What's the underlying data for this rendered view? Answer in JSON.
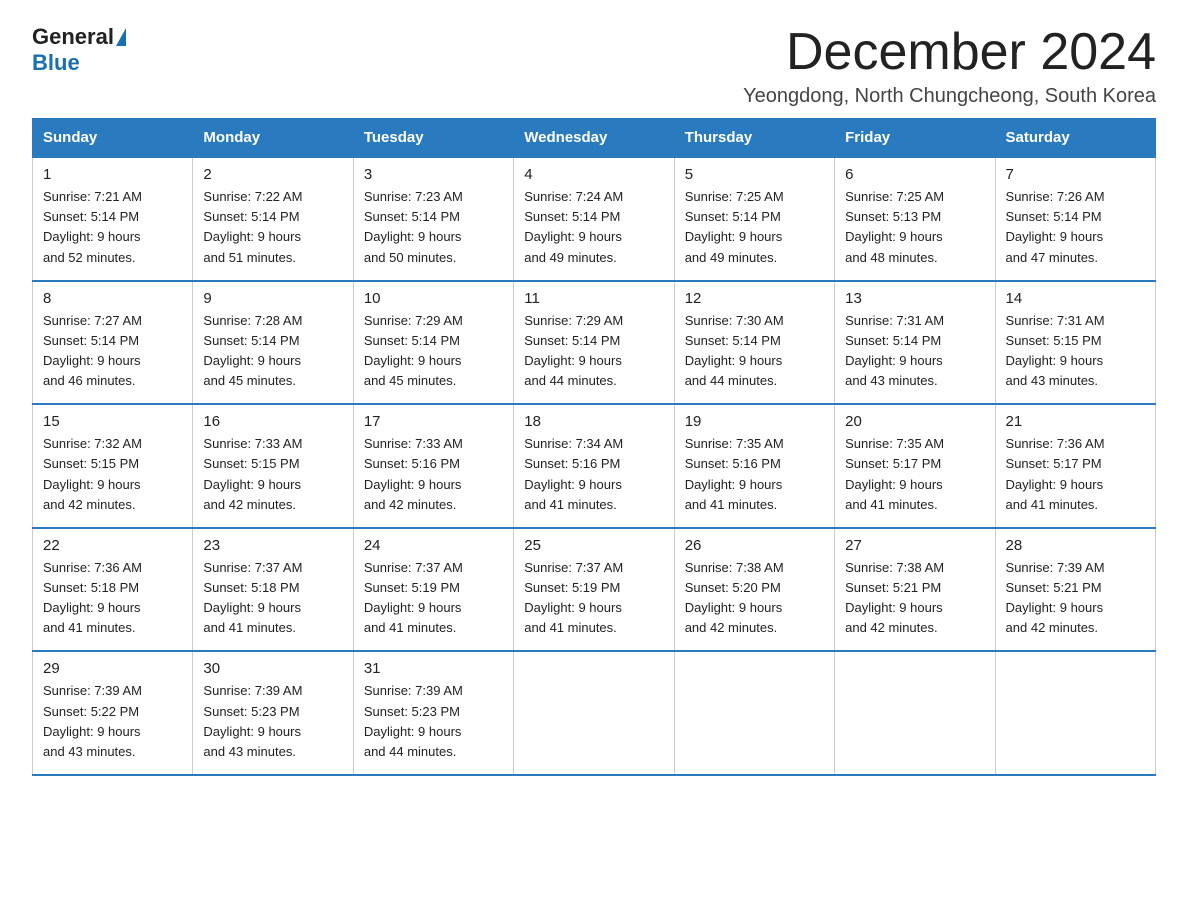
{
  "logo": {
    "general": "General",
    "blue": "Blue"
  },
  "header": {
    "month_title": "December 2024",
    "subtitle": "Yeongdong, North Chungcheong, South Korea"
  },
  "weekdays": [
    "Sunday",
    "Monday",
    "Tuesday",
    "Wednesday",
    "Thursday",
    "Friday",
    "Saturday"
  ],
  "weeks": [
    [
      {
        "day": "1",
        "sunrise": "7:21 AM",
        "sunset": "5:14 PM",
        "daylight": "9 hours and 52 minutes."
      },
      {
        "day": "2",
        "sunrise": "7:22 AM",
        "sunset": "5:14 PM",
        "daylight": "9 hours and 51 minutes."
      },
      {
        "day": "3",
        "sunrise": "7:23 AM",
        "sunset": "5:14 PM",
        "daylight": "9 hours and 50 minutes."
      },
      {
        "day": "4",
        "sunrise": "7:24 AM",
        "sunset": "5:14 PM",
        "daylight": "9 hours and 49 minutes."
      },
      {
        "day": "5",
        "sunrise": "7:25 AM",
        "sunset": "5:14 PM",
        "daylight": "9 hours and 49 minutes."
      },
      {
        "day": "6",
        "sunrise": "7:25 AM",
        "sunset": "5:13 PM",
        "daylight": "9 hours and 48 minutes."
      },
      {
        "day": "7",
        "sunrise": "7:26 AM",
        "sunset": "5:14 PM",
        "daylight": "9 hours and 47 minutes."
      }
    ],
    [
      {
        "day": "8",
        "sunrise": "7:27 AM",
        "sunset": "5:14 PM",
        "daylight": "9 hours and 46 minutes."
      },
      {
        "day": "9",
        "sunrise": "7:28 AM",
        "sunset": "5:14 PM",
        "daylight": "9 hours and 45 minutes."
      },
      {
        "day": "10",
        "sunrise": "7:29 AM",
        "sunset": "5:14 PM",
        "daylight": "9 hours and 45 minutes."
      },
      {
        "day": "11",
        "sunrise": "7:29 AM",
        "sunset": "5:14 PM",
        "daylight": "9 hours and 44 minutes."
      },
      {
        "day": "12",
        "sunrise": "7:30 AM",
        "sunset": "5:14 PM",
        "daylight": "9 hours and 44 minutes."
      },
      {
        "day": "13",
        "sunrise": "7:31 AM",
        "sunset": "5:14 PM",
        "daylight": "9 hours and 43 minutes."
      },
      {
        "day": "14",
        "sunrise": "7:31 AM",
        "sunset": "5:15 PM",
        "daylight": "9 hours and 43 minutes."
      }
    ],
    [
      {
        "day": "15",
        "sunrise": "7:32 AM",
        "sunset": "5:15 PM",
        "daylight": "9 hours and 42 minutes."
      },
      {
        "day": "16",
        "sunrise": "7:33 AM",
        "sunset": "5:15 PM",
        "daylight": "9 hours and 42 minutes."
      },
      {
        "day": "17",
        "sunrise": "7:33 AM",
        "sunset": "5:16 PM",
        "daylight": "9 hours and 42 minutes."
      },
      {
        "day": "18",
        "sunrise": "7:34 AM",
        "sunset": "5:16 PM",
        "daylight": "9 hours and 41 minutes."
      },
      {
        "day": "19",
        "sunrise": "7:35 AM",
        "sunset": "5:16 PM",
        "daylight": "9 hours and 41 minutes."
      },
      {
        "day": "20",
        "sunrise": "7:35 AM",
        "sunset": "5:17 PM",
        "daylight": "9 hours and 41 minutes."
      },
      {
        "day": "21",
        "sunrise": "7:36 AM",
        "sunset": "5:17 PM",
        "daylight": "9 hours and 41 minutes."
      }
    ],
    [
      {
        "day": "22",
        "sunrise": "7:36 AM",
        "sunset": "5:18 PM",
        "daylight": "9 hours and 41 minutes."
      },
      {
        "day": "23",
        "sunrise": "7:37 AM",
        "sunset": "5:18 PM",
        "daylight": "9 hours and 41 minutes."
      },
      {
        "day": "24",
        "sunrise": "7:37 AM",
        "sunset": "5:19 PM",
        "daylight": "9 hours and 41 minutes."
      },
      {
        "day": "25",
        "sunrise": "7:37 AM",
        "sunset": "5:19 PM",
        "daylight": "9 hours and 41 minutes."
      },
      {
        "day": "26",
        "sunrise": "7:38 AM",
        "sunset": "5:20 PM",
        "daylight": "9 hours and 42 minutes."
      },
      {
        "day": "27",
        "sunrise": "7:38 AM",
        "sunset": "5:21 PM",
        "daylight": "9 hours and 42 minutes."
      },
      {
        "day": "28",
        "sunrise": "7:39 AM",
        "sunset": "5:21 PM",
        "daylight": "9 hours and 42 minutes."
      }
    ],
    [
      {
        "day": "29",
        "sunrise": "7:39 AM",
        "sunset": "5:22 PM",
        "daylight": "9 hours and 43 minutes."
      },
      {
        "day": "30",
        "sunrise": "7:39 AM",
        "sunset": "5:23 PM",
        "daylight": "9 hours and 43 minutes."
      },
      {
        "day": "31",
        "sunrise": "7:39 AM",
        "sunset": "5:23 PM",
        "daylight": "9 hours and 44 minutes."
      },
      null,
      null,
      null,
      null
    ]
  ]
}
